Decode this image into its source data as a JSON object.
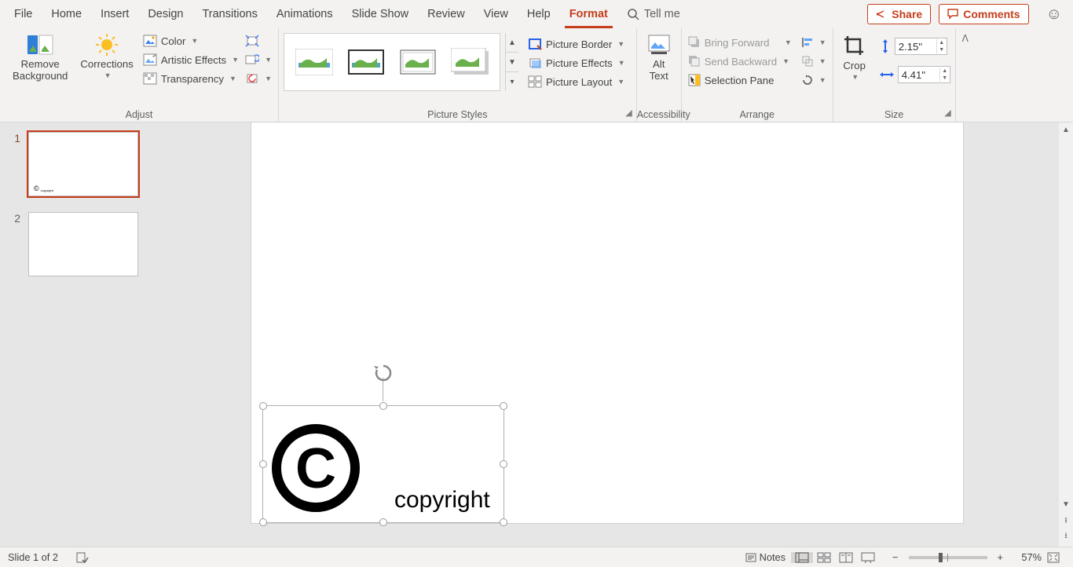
{
  "tabs": [
    "File",
    "Home",
    "Insert",
    "Design",
    "Transitions",
    "Animations",
    "Slide Show",
    "Review",
    "View",
    "Help",
    "Format"
  ],
  "active_tab": "Format",
  "tell_me": "Tell me",
  "share": "Share",
  "comments": "Comments",
  "adjust": {
    "remove_bg": "Remove\nBackground",
    "corrections": "Corrections",
    "color": "Color",
    "artistic": "Artistic Effects",
    "transparency": "Transparency",
    "label": "Adjust"
  },
  "picture_styles": {
    "border": "Picture Border",
    "effects": "Picture Effects",
    "layout": "Picture Layout",
    "label": "Picture Styles"
  },
  "accessibility": {
    "alt": "Alt\nText",
    "label": "Accessibility"
  },
  "arrange": {
    "bring_forward": "Bring Forward",
    "send_backward": "Send Backward",
    "selection_pane": "Selection Pane",
    "label": "Arrange"
  },
  "size": {
    "crop": "Crop",
    "height": "2.15\"",
    "width": "4.41\"",
    "label": "Size"
  },
  "thumb": {
    "s1": "1",
    "s2": "2",
    "copyright": "copyright"
  },
  "slide": {
    "copyright": "copyright"
  },
  "status": {
    "text": "Slide 1 of 2",
    "notes": "Notes",
    "zoom": "57%"
  }
}
